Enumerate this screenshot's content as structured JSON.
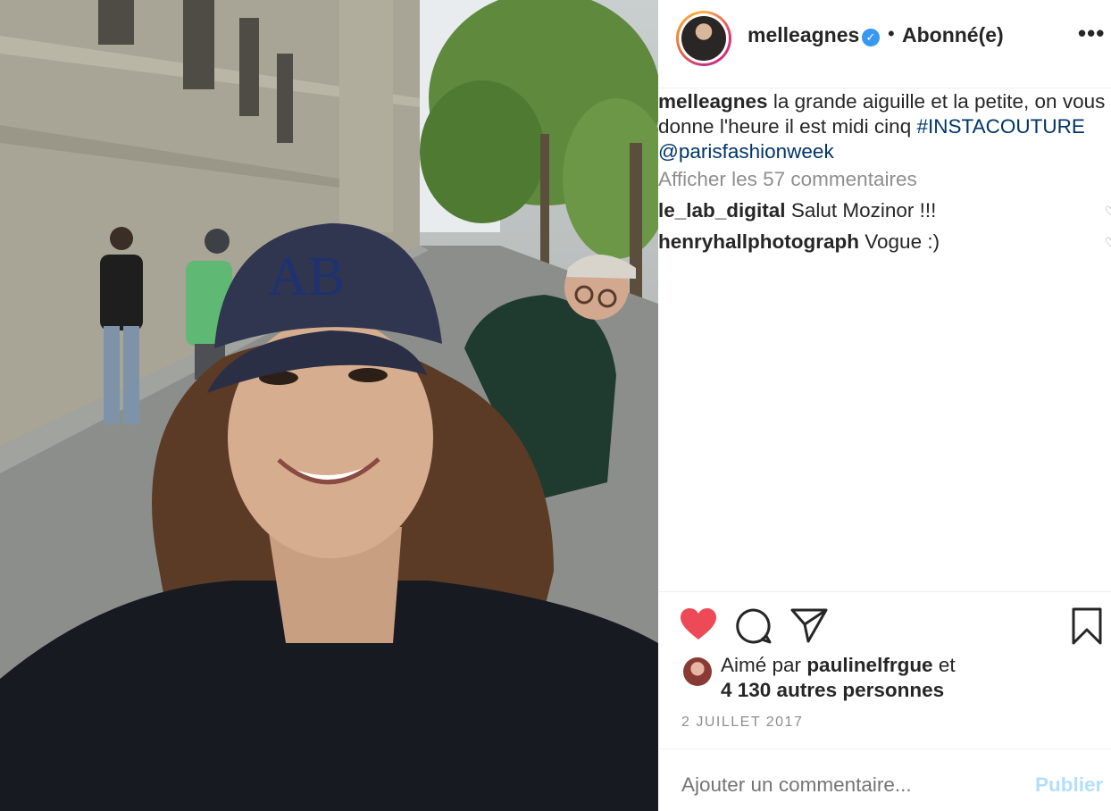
{
  "post": {
    "image_alt": "Selfie in a Paris street",
    "cap_letters": "AB"
  },
  "header": {
    "username": "melleagnes",
    "verified_icon": "verified-badge-icon",
    "separator": "•",
    "follow_status": "Abonné(e)",
    "more_icon": "more-options-icon",
    "more_label": "•••"
  },
  "caption": {
    "username": "melleagnes",
    "text": "la grande aiguille et la petite, on vous donne l'heure il est midi cinq",
    "hashtag": "#INSTACOUTURE",
    "mention": "@parisfashionweek"
  },
  "comments": {
    "view_all": "Afficher les 57 commentaires",
    "items": [
      {
        "user": "le_lab_digital",
        "text": "Salut Mozinor !!!"
      },
      {
        "user": "henryhallphotograph",
        "text": "Vogue :)"
      }
    ]
  },
  "actions": {
    "like_icon": "heart-filled-icon",
    "comment_icon": "comment-icon",
    "share_icon": "share-icon",
    "save_icon": "bookmark-icon",
    "like_color": "#ed4956"
  },
  "likes": {
    "prefix": "Aimé par",
    "user": "paulinelfrgue",
    "suffix": "et",
    "others": "4 130 autres personnes"
  },
  "date": "2 JUILLET 2017",
  "add_comment": {
    "placeholder": "Ajouter un commentaire...",
    "publish_label": "Publier"
  }
}
